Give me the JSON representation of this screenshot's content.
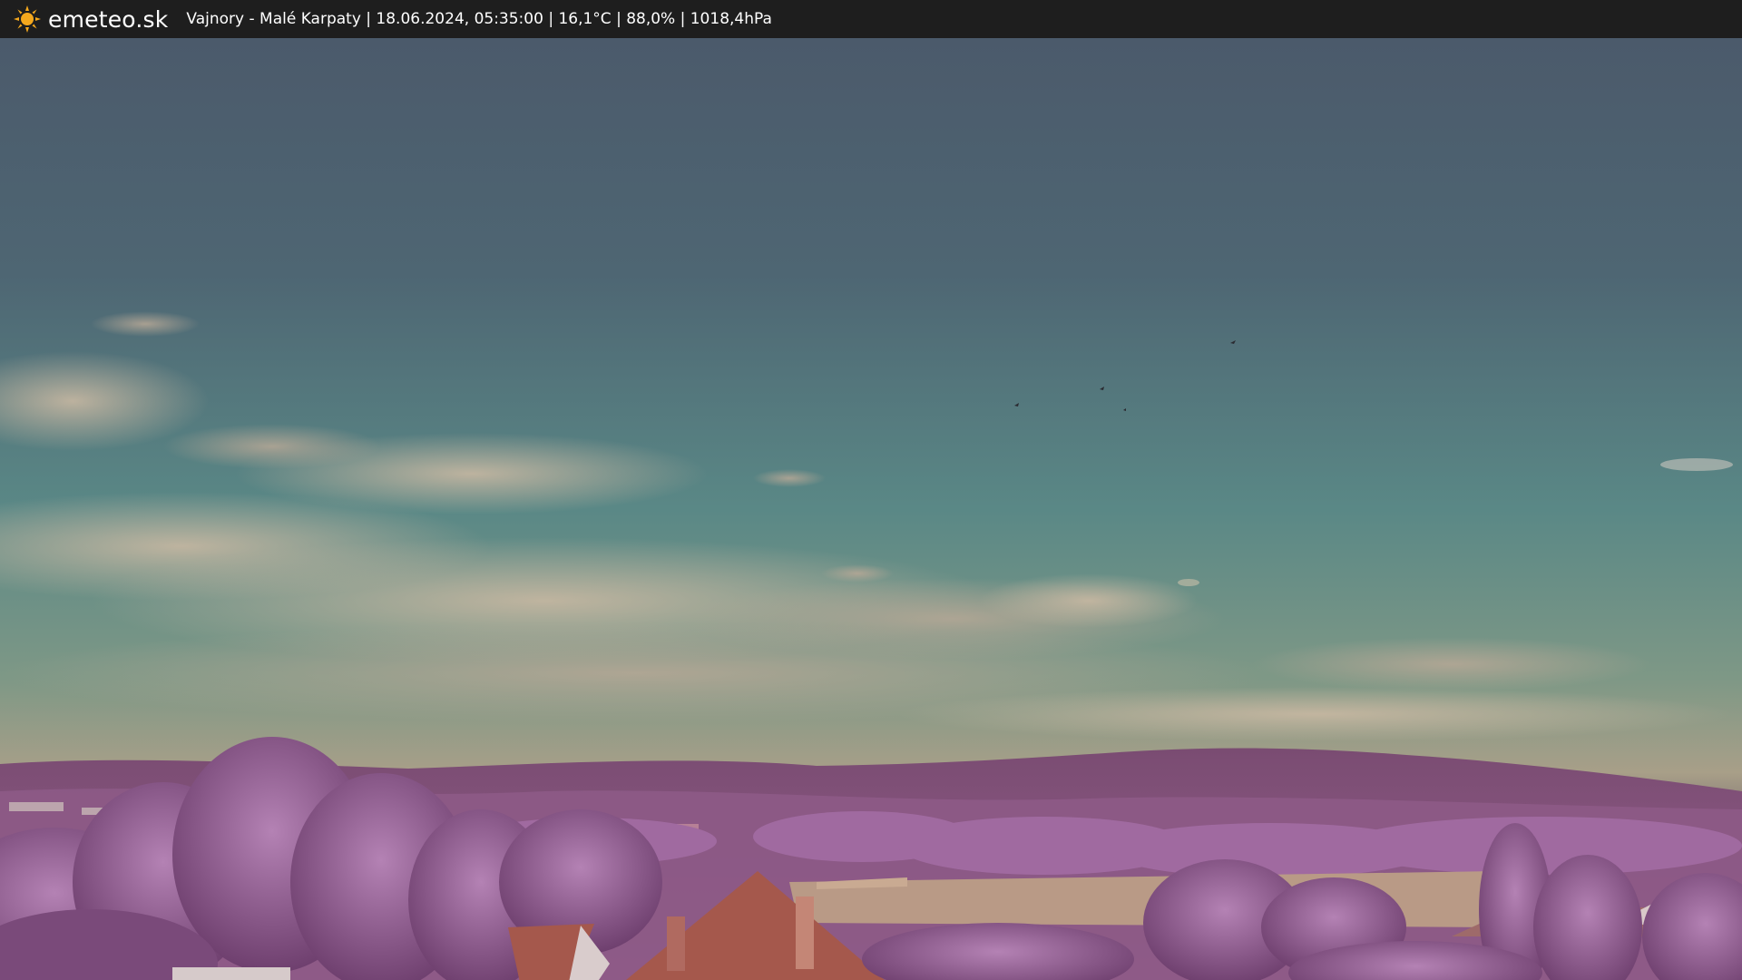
{
  "header": {
    "brand": "emeteo.sk",
    "caption": "Vajnory - Malé Karpaty | 18.06.2024, 05:35:00 | 16,1°C | 88,0% | 1018,4hPa",
    "logo_icon": "sun-icon",
    "logo_color": "#f4a81d",
    "bar_color": "#1e1e1e"
  },
  "scene": {
    "description_icon": "webcam-image",
    "sky_top": "#4a5a6a",
    "sky_mid": "#5a8585",
    "horizon": "#a89c88",
    "foliage": "#9e6a9e",
    "roof": "#a5584c"
  }
}
